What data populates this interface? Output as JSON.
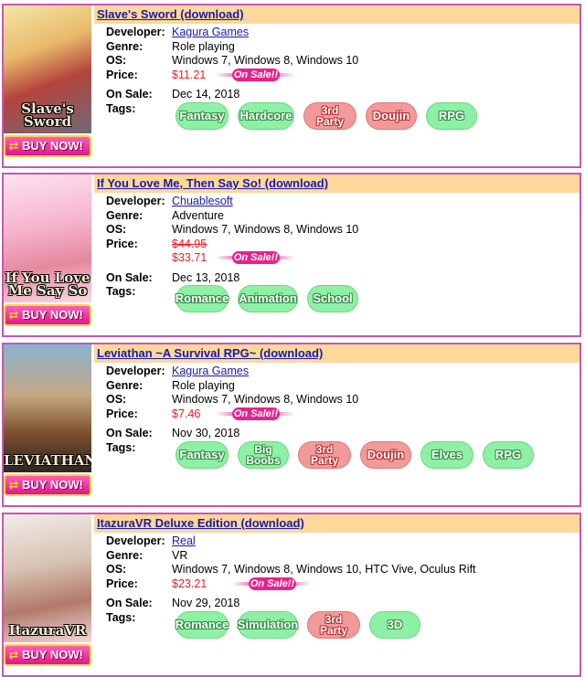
{
  "games": [
    {
      "title": "Slave's Sword (download)",
      "cover_title": "Slave's Sword",
      "buy_label": "BUY NOW!",
      "developer": "Kagura Games",
      "genre": "Role playing",
      "os": "Windows 7, Windows 8, Windows 10",
      "price": "$11.21",
      "on_sale_badge": "On Sale!!",
      "on_sale_date": "Dec 14, 2018",
      "tags": [
        {
          "label": "Fantasy",
          "color": "green"
        },
        {
          "label": "Hardcore",
          "color": "green"
        },
        {
          "label": "3rd Party",
          "color": "red"
        },
        {
          "label": "Doujin",
          "color": "red"
        },
        {
          "label": "RPG",
          "color": "green"
        }
      ]
    },
    {
      "title": "If You Love Me, Then Say So! (download)",
      "cover_title": "If You Love Me Say So",
      "buy_label": "BUY NOW!",
      "developer": "Chuablesoft",
      "genre": "Adventure",
      "os": "Windows 7, Windows 8, Windows 10",
      "old_price": "$44.95",
      "price": "$33.71",
      "on_sale_badge": "On Sale!!",
      "on_sale_date": "Dec 13, 2018",
      "tags": [
        {
          "label": "Romance",
          "color": "green"
        },
        {
          "label": "Animation",
          "color": "green"
        },
        {
          "label": "School",
          "color": "green"
        }
      ]
    },
    {
      "title": "Leviathan ~A Survival RPG~ (download)",
      "cover_title": "LEVIATHAN",
      "buy_label": "BUY NOW!",
      "developer": "Kagura Games",
      "genre": "Role playing",
      "os": "Windows 7, Windows 8, Windows 10",
      "price": "$7.46",
      "on_sale_badge": "On Sale!!",
      "on_sale_date": "Nov 30, 2018",
      "tags": [
        {
          "label": "Fantasy",
          "color": "green"
        },
        {
          "label": "Big Boobs",
          "color": "green"
        },
        {
          "label": "3rd Party",
          "color": "red"
        },
        {
          "label": "Doujin",
          "color": "red"
        },
        {
          "label": "Elves",
          "color": "green"
        },
        {
          "label": "RPG",
          "color": "green"
        }
      ]
    },
    {
      "title": "ItazuraVR Deluxe Edition (download)",
      "cover_title": "ItazuraVR",
      "buy_label": "BUY NOW!",
      "developer": "Real",
      "genre": "VR",
      "os": "Windows 7, Windows 8, Windows 10, HTC Vive, Oculus Rift",
      "price": "$23.21",
      "on_sale_badge": "On Sale!!",
      "on_sale_date": "Nov 29, 2018",
      "tags": [
        {
          "label": "Romance",
          "color": "green"
        },
        {
          "label": "Simulation",
          "color": "green"
        },
        {
          "label": "3rd Party",
          "color": "red"
        },
        {
          "label": "3D",
          "color": "green"
        }
      ]
    }
  ],
  "labels": {
    "developer": "Developer:",
    "genre": "Genre:",
    "os": "OS:",
    "price": "Price:",
    "on_sale": "On Sale:",
    "tags": "Tags:"
  },
  "colors": {
    "card_border": "#c856b5",
    "title_bar": "#fdd89a",
    "link": "#1a1aa8",
    "price": "#ee1c24",
    "sale_badge": "#e8228c",
    "tag_green": "#8ef0a5",
    "tag_red": "#f29a9a"
  }
}
